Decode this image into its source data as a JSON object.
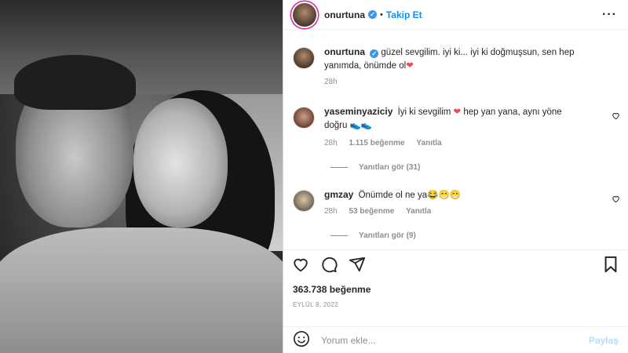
{
  "header": {
    "username": "onurtuna",
    "separator": "•",
    "follow_label": "Takip Et",
    "more_icon": "ellipsis-icon",
    "verified_icon": "verified-badge-icon"
  },
  "caption": {
    "username": "onurtuna",
    "text": "güzel sevgilim. iyi ki... iyi ki doğmuşsun, sen hep yanımda, önümde ol",
    "emoji": "❤",
    "time": "28h"
  },
  "comments": [
    {
      "username": "yaseminyaziciy",
      "text_before": "İyi ki sevgilim",
      "emoji": "❤",
      "text_after": "hep yan yana, aynı yöne doğru 👟👟",
      "time": "28h",
      "likes": "1.115 beğenme",
      "reply": "Yanıtla",
      "view_replies": "Yanıtları gör (31)"
    },
    {
      "username": "gmzay",
      "text": "Önümde ol ne ya😂😁😁",
      "time": "28h",
      "likes": "53 beğenme",
      "reply": "Yanıtla",
      "view_replies": "Yanıtları gör (9)"
    }
  ],
  "actions": {
    "like_icon": "heart-icon",
    "comment_icon": "comment-icon",
    "share_icon": "paper-plane-icon",
    "save_icon": "bookmark-icon"
  },
  "likes_count": "363.738 beğenme",
  "date": "EYLÜL 8, 2022",
  "add_comment": {
    "placeholder": "Yorum ekle...",
    "post_label": "Paylaş",
    "emoji_icon": "smiley-icon"
  },
  "colors": {
    "accent": "#0095f6",
    "verified": "#3897f0",
    "heart": "#ed4956",
    "muted": "#8e8e8e",
    "post_disabled": "#b2dffc"
  }
}
